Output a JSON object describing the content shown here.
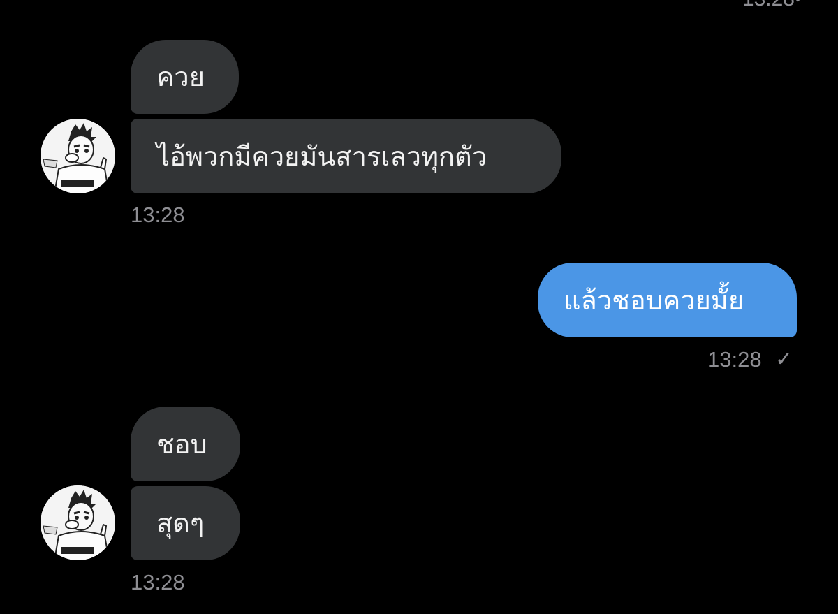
{
  "messages": [
    {
      "text": "ควย",
      "direction": "incoming"
    },
    {
      "text": "ไอ้พวกมีควยมันสารเลวทุกตัว",
      "direction": "incoming",
      "time": "13:28"
    },
    {
      "text": "แล้วชอบควยมั้ย",
      "direction": "outgoing",
      "time": "13:28",
      "status": "sent-check-icon"
    },
    {
      "text": "ชอบ",
      "direction": "incoming"
    },
    {
      "text": "สุดๆ",
      "direction": "incoming",
      "time": "13:28"
    }
  ],
  "colors": {
    "background": "#000000",
    "incoming_bubble": "#323436",
    "outgoing_bubble": "#4b96e6",
    "timestamp": "#8e8e93"
  },
  "icons": {
    "check": "✓",
    "avatar": "contact-avatar-illustration"
  }
}
